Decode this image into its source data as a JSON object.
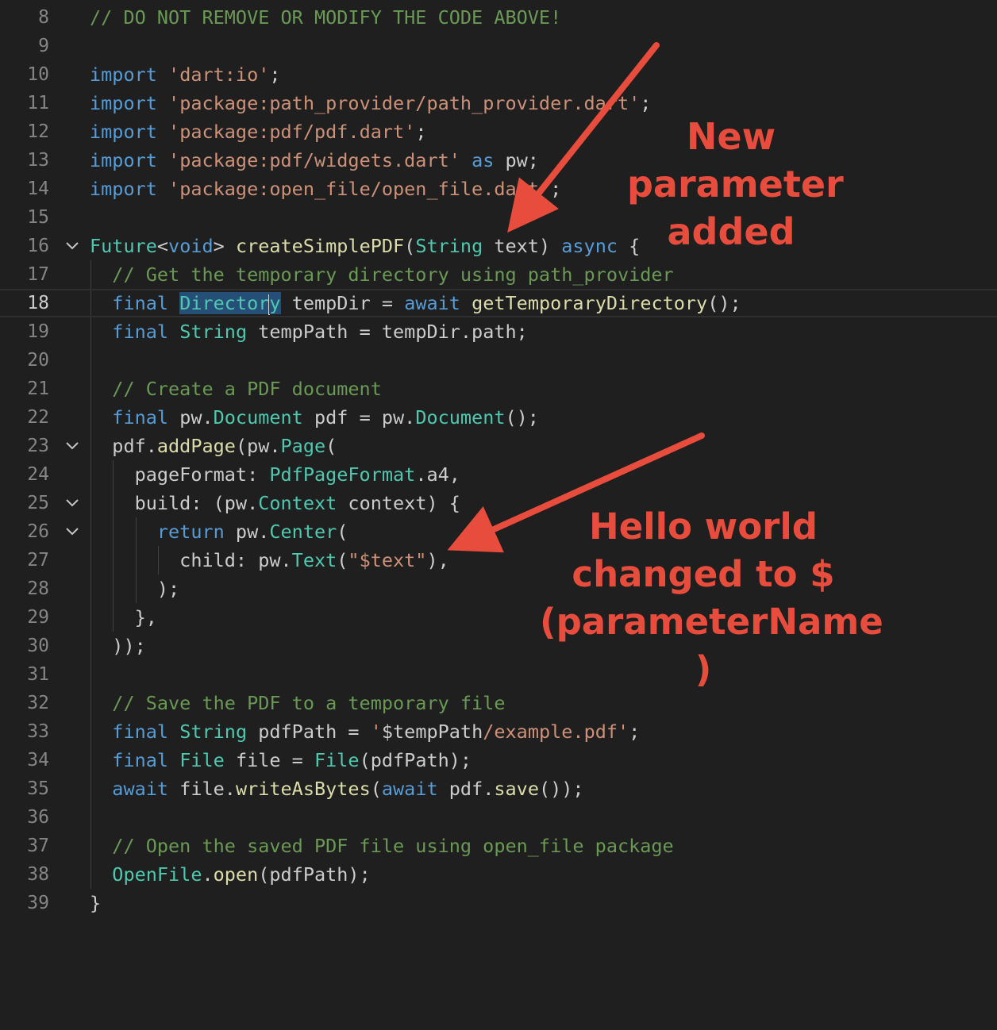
{
  "editor": {
    "current_line": "18",
    "lines": [
      {
        "n": "8",
        "fold": false,
        "guides": [],
        "tokens": [
          {
            "t": "// DO NOT REMOVE OR MODIFY THE CODE ABOVE!",
            "c": "cm"
          }
        ]
      },
      {
        "n": "9",
        "fold": false,
        "guides": [],
        "tokens": []
      },
      {
        "n": "10",
        "fold": false,
        "guides": [],
        "tokens": [
          {
            "t": "import",
            "c": "kw"
          },
          {
            "t": " ",
            "c": "id"
          },
          {
            "t": "'dart:io'",
            "c": "str"
          },
          {
            "t": ";",
            "c": "id"
          }
        ]
      },
      {
        "n": "11",
        "fold": false,
        "guides": [],
        "tokens": [
          {
            "t": "import",
            "c": "kw"
          },
          {
            "t": " ",
            "c": "id"
          },
          {
            "t": "'package:path_provider/path_provider.dart'",
            "c": "str"
          },
          {
            "t": ";",
            "c": "id"
          }
        ]
      },
      {
        "n": "12",
        "fold": false,
        "guides": [],
        "tokens": [
          {
            "t": "import",
            "c": "kw"
          },
          {
            "t": " ",
            "c": "id"
          },
          {
            "t": "'package:pdf/pdf.dart'",
            "c": "str"
          },
          {
            "t": ";",
            "c": "id"
          }
        ]
      },
      {
        "n": "13",
        "fold": false,
        "guides": [],
        "tokens": [
          {
            "t": "import",
            "c": "kw"
          },
          {
            "t": " ",
            "c": "id"
          },
          {
            "t": "'package:pdf/widgets.dart'",
            "c": "str"
          },
          {
            "t": " ",
            "c": "id"
          },
          {
            "t": "as",
            "c": "kw"
          },
          {
            "t": " pw;",
            "c": "id"
          }
        ]
      },
      {
        "n": "14",
        "fold": false,
        "guides": [],
        "tokens": [
          {
            "t": "import",
            "c": "kw"
          },
          {
            "t": " ",
            "c": "id"
          },
          {
            "t": "'package:open_file/open_file.dart'",
            "c": "str"
          },
          {
            "t": ";",
            "c": "id"
          }
        ]
      },
      {
        "n": "15",
        "fold": false,
        "guides": [],
        "tokens": []
      },
      {
        "n": "16",
        "fold": true,
        "guides": [],
        "tokens": [
          {
            "t": "Future",
            "c": "ty"
          },
          {
            "t": "<",
            "c": "id"
          },
          {
            "t": "void",
            "c": "kw"
          },
          {
            "t": "> ",
            "c": "id"
          },
          {
            "t": "createSimplePDF",
            "c": "fn"
          },
          {
            "t": "(",
            "c": "id"
          },
          {
            "t": "String",
            "c": "ty"
          },
          {
            "t": " text) ",
            "c": "id"
          },
          {
            "t": "async",
            "c": "kw"
          },
          {
            "t": " {",
            "c": "id"
          }
        ]
      },
      {
        "n": "17",
        "fold": false,
        "guides": [
          1
        ],
        "tokens": [
          {
            "t": "  // Get the temporary directory using path_provider",
            "c": "cm"
          }
        ]
      },
      {
        "n": "18",
        "fold": false,
        "guides": [
          1
        ],
        "tokens": [
          {
            "t": "  ",
            "c": "id"
          },
          {
            "t": "final",
            "c": "kw"
          },
          {
            "t": " ",
            "c": "id"
          },
          {
            "t": "Director",
            "c": "ty hl"
          },
          {
            "t": "",
            "c": "caret"
          },
          {
            "t": "y",
            "c": "ty hl"
          },
          {
            "t": " tempDir = ",
            "c": "id"
          },
          {
            "t": "await",
            "c": "kw"
          },
          {
            "t": " ",
            "c": "id"
          },
          {
            "t": "getTemporaryDirectory",
            "c": "fn"
          },
          {
            "t": "();",
            "c": "id"
          }
        ]
      },
      {
        "n": "19",
        "fold": false,
        "guides": [
          1
        ],
        "tokens": [
          {
            "t": "  ",
            "c": "id"
          },
          {
            "t": "final",
            "c": "kw"
          },
          {
            "t": " ",
            "c": "id"
          },
          {
            "t": "String",
            "c": "ty"
          },
          {
            "t": " tempPath = tempDir.path;",
            "c": "id"
          }
        ]
      },
      {
        "n": "20",
        "fold": false,
        "guides": [
          1
        ],
        "tokens": []
      },
      {
        "n": "21",
        "fold": false,
        "guides": [
          1
        ],
        "tokens": [
          {
            "t": "  // Create a PDF document",
            "c": "cm"
          }
        ]
      },
      {
        "n": "22",
        "fold": false,
        "guides": [
          1
        ],
        "tokens": [
          {
            "t": "  ",
            "c": "id"
          },
          {
            "t": "final",
            "c": "kw"
          },
          {
            "t": " pw.",
            "c": "id"
          },
          {
            "t": "Document",
            "c": "ty"
          },
          {
            "t": " pdf = pw.",
            "c": "id"
          },
          {
            "t": "Document",
            "c": "ty"
          },
          {
            "t": "();",
            "c": "id"
          }
        ]
      },
      {
        "n": "23",
        "fold": true,
        "guides": [
          1
        ],
        "tokens": [
          {
            "t": "  pdf.",
            "c": "id"
          },
          {
            "t": "addPage",
            "c": "fn"
          },
          {
            "t": "(pw.",
            "c": "id"
          },
          {
            "t": "Page",
            "c": "ty"
          },
          {
            "t": "(",
            "c": "id"
          }
        ]
      },
      {
        "n": "24",
        "fold": false,
        "guides": [
          1,
          2
        ],
        "tokens": [
          {
            "t": "    pageFormat: ",
            "c": "id"
          },
          {
            "t": "PdfPageFormat",
            "c": "ty"
          },
          {
            "t": ".a4,",
            "c": "id"
          }
        ]
      },
      {
        "n": "25",
        "fold": true,
        "guides": [
          1,
          2
        ],
        "tokens": [
          {
            "t": "    build: (pw.",
            "c": "id"
          },
          {
            "t": "Context",
            "c": "ty"
          },
          {
            "t": " context) {",
            "c": "id"
          }
        ]
      },
      {
        "n": "26",
        "fold": true,
        "guides": [
          1,
          2,
          3
        ],
        "tokens": [
          {
            "t": "      ",
            "c": "id"
          },
          {
            "t": "return",
            "c": "kw"
          },
          {
            "t": " pw.",
            "c": "id"
          },
          {
            "t": "Center",
            "c": "ty"
          },
          {
            "t": "(",
            "c": "id"
          }
        ]
      },
      {
        "n": "27",
        "fold": false,
        "guides": [
          1,
          2,
          3,
          4
        ],
        "tokens": [
          {
            "t": "        child: pw.",
            "c": "id"
          },
          {
            "t": "Text",
            "c": "ty"
          },
          {
            "t": "(",
            "c": "id"
          },
          {
            "t": "\"$text\"",
            "c": "str"
          },
          {
            "t": "),",
            "c": "id"
          }
        ]
      },
      {
        "n": "28",
        "fold": false,
        "guides": [
          1,
          2,
          3
        ],
        "tokens": [
          {
            "t": "      );",
            "c": "id"
          }
        ]
      },
      {
        "n": "29",
        "fold": false,
        "guides": [
          1,
          2
        ],
        "tokens": [
          {
            "t": "    },",
            "c": "id"
          }
        ]
      },
      {
        "n": "30",
        "fold": false,
        "guides": [
          1
        ],
        "tokens": [
          {
            "t": "  ));",
            "c": "id"
          }
        ]
      },
      {
        "n": "31",
        "fold": false,
        "guides": [
          1
        ],
        "tokens": []
      },
      {
        "n": "32",
        "fold": false,
        "guides": [
          1
        ],
        "tokens": [
          {
            "t": "  // Save the PDF to a temporary file",
            "c": "cm"
          }
        ]
      },
      {
        "n": "33",
        "fold": false,
        "guides": [
          1
        ],
        "tokens": [
          {
            "t": "  ",
            "c": "id"
          },
          {
            "t": "final",
            "c": "kw"
          },
          {
            "t": " ",
            "c": "id"
          },
          {
            "t": "String",
            "c": "ty"
          },
          {
            "t": " pdfPath = ",
            "c": "id"
          },
          {
            "t": "'",
            "c": "str"
          },
          {
            "t": "$tempPath",
            "c": "id"
          },
          {
            "t": "/example.pdf'",
            "c": "str"
          },
          {
            "t": ";",
            "c": "id"
          }
        ]
      },
      {
        "n": "34",
        "fold": false,
        "guides": [
          1
        ],
        "tokens": [
          {
            "t": "  ",
            "c": "id"
          },
          {
            "t": "final",
            "c": "kw"
          },
          {
            "t": " ",
            "c": "id"
          },
          {
            "t": "File",
            "c": "ty"
          },
          {
            "t": " file = ",
            "c": "id"
          },
          {
            "t": "File",
            "c": "ty"
          },
          {
            "t": "(pdfPath);",
            "c": "id"
          }
        ]
      },
      {
        "n": "35",
        "fold": false,
        "guides": [
          1
        ],
        "tokens": [
          {
            "t": "  ",
            "c": "id"
          },
          {
            "t": "await",
            "c": "kw"
          },
          {
            "t": " file.",
            "c": "id"
          },
          {
            "t": "writeAsBytes",
            "c": "fn"
          },
          {
            "t": "(",
            "c": "id"
          },
          {
            "t": "await",
            "c": "kw"
          },
          {
            "t": " pdf.",
            "c": "id"
          },
          {
            "t": "save",
            "c": "fn"
          },
          {
            "t": "());",
            "c": "id"
          }
        ]
      },
      {
        "n": "36",
        "fold": false,
        "guides": [
          1
        ],
        "tokens": []
      },
      {
        "n": "37",
        "fold": false,
        "guides": [
          1
        ],
        "tokens": [
          {
            "t": "  // Open the saved PDF file using open_file package",
            "c": "cm"
          }
        ]
      },
      {
        "n": "38",
        "fold": false,
        "guides": [
          1
        ],
        "tokens": [
          {
            "t": "  ",
            "c": "id"
          },
          {
            "t": "OpenFile",
            "c": "ty"
          },
          {
            "t": ".",
            "c": "id"
          },
          {
            "t": "open",
            "c": "fn"
          },
          {
            "t": "(pdfPath);",
            "c": "id"
          }
        ]
      },
      {
        "n": "39",
        "fold": false,
        "guides": [],
        "tokens": [
          {
            "t": "}",
            "c": "id"
          }
        ]
      }
    ]
  },
  "annotations": {
    "note1": {
      "lines": [
        "New",
        "parameter",
        "added"
      ]
    },
    "note2": {
      "lines": [
        "Hello world",
        "changed to $",
        "(parameterName",
        ")"
      ]
    },
    "color": "#e74c3c"
  }
}
